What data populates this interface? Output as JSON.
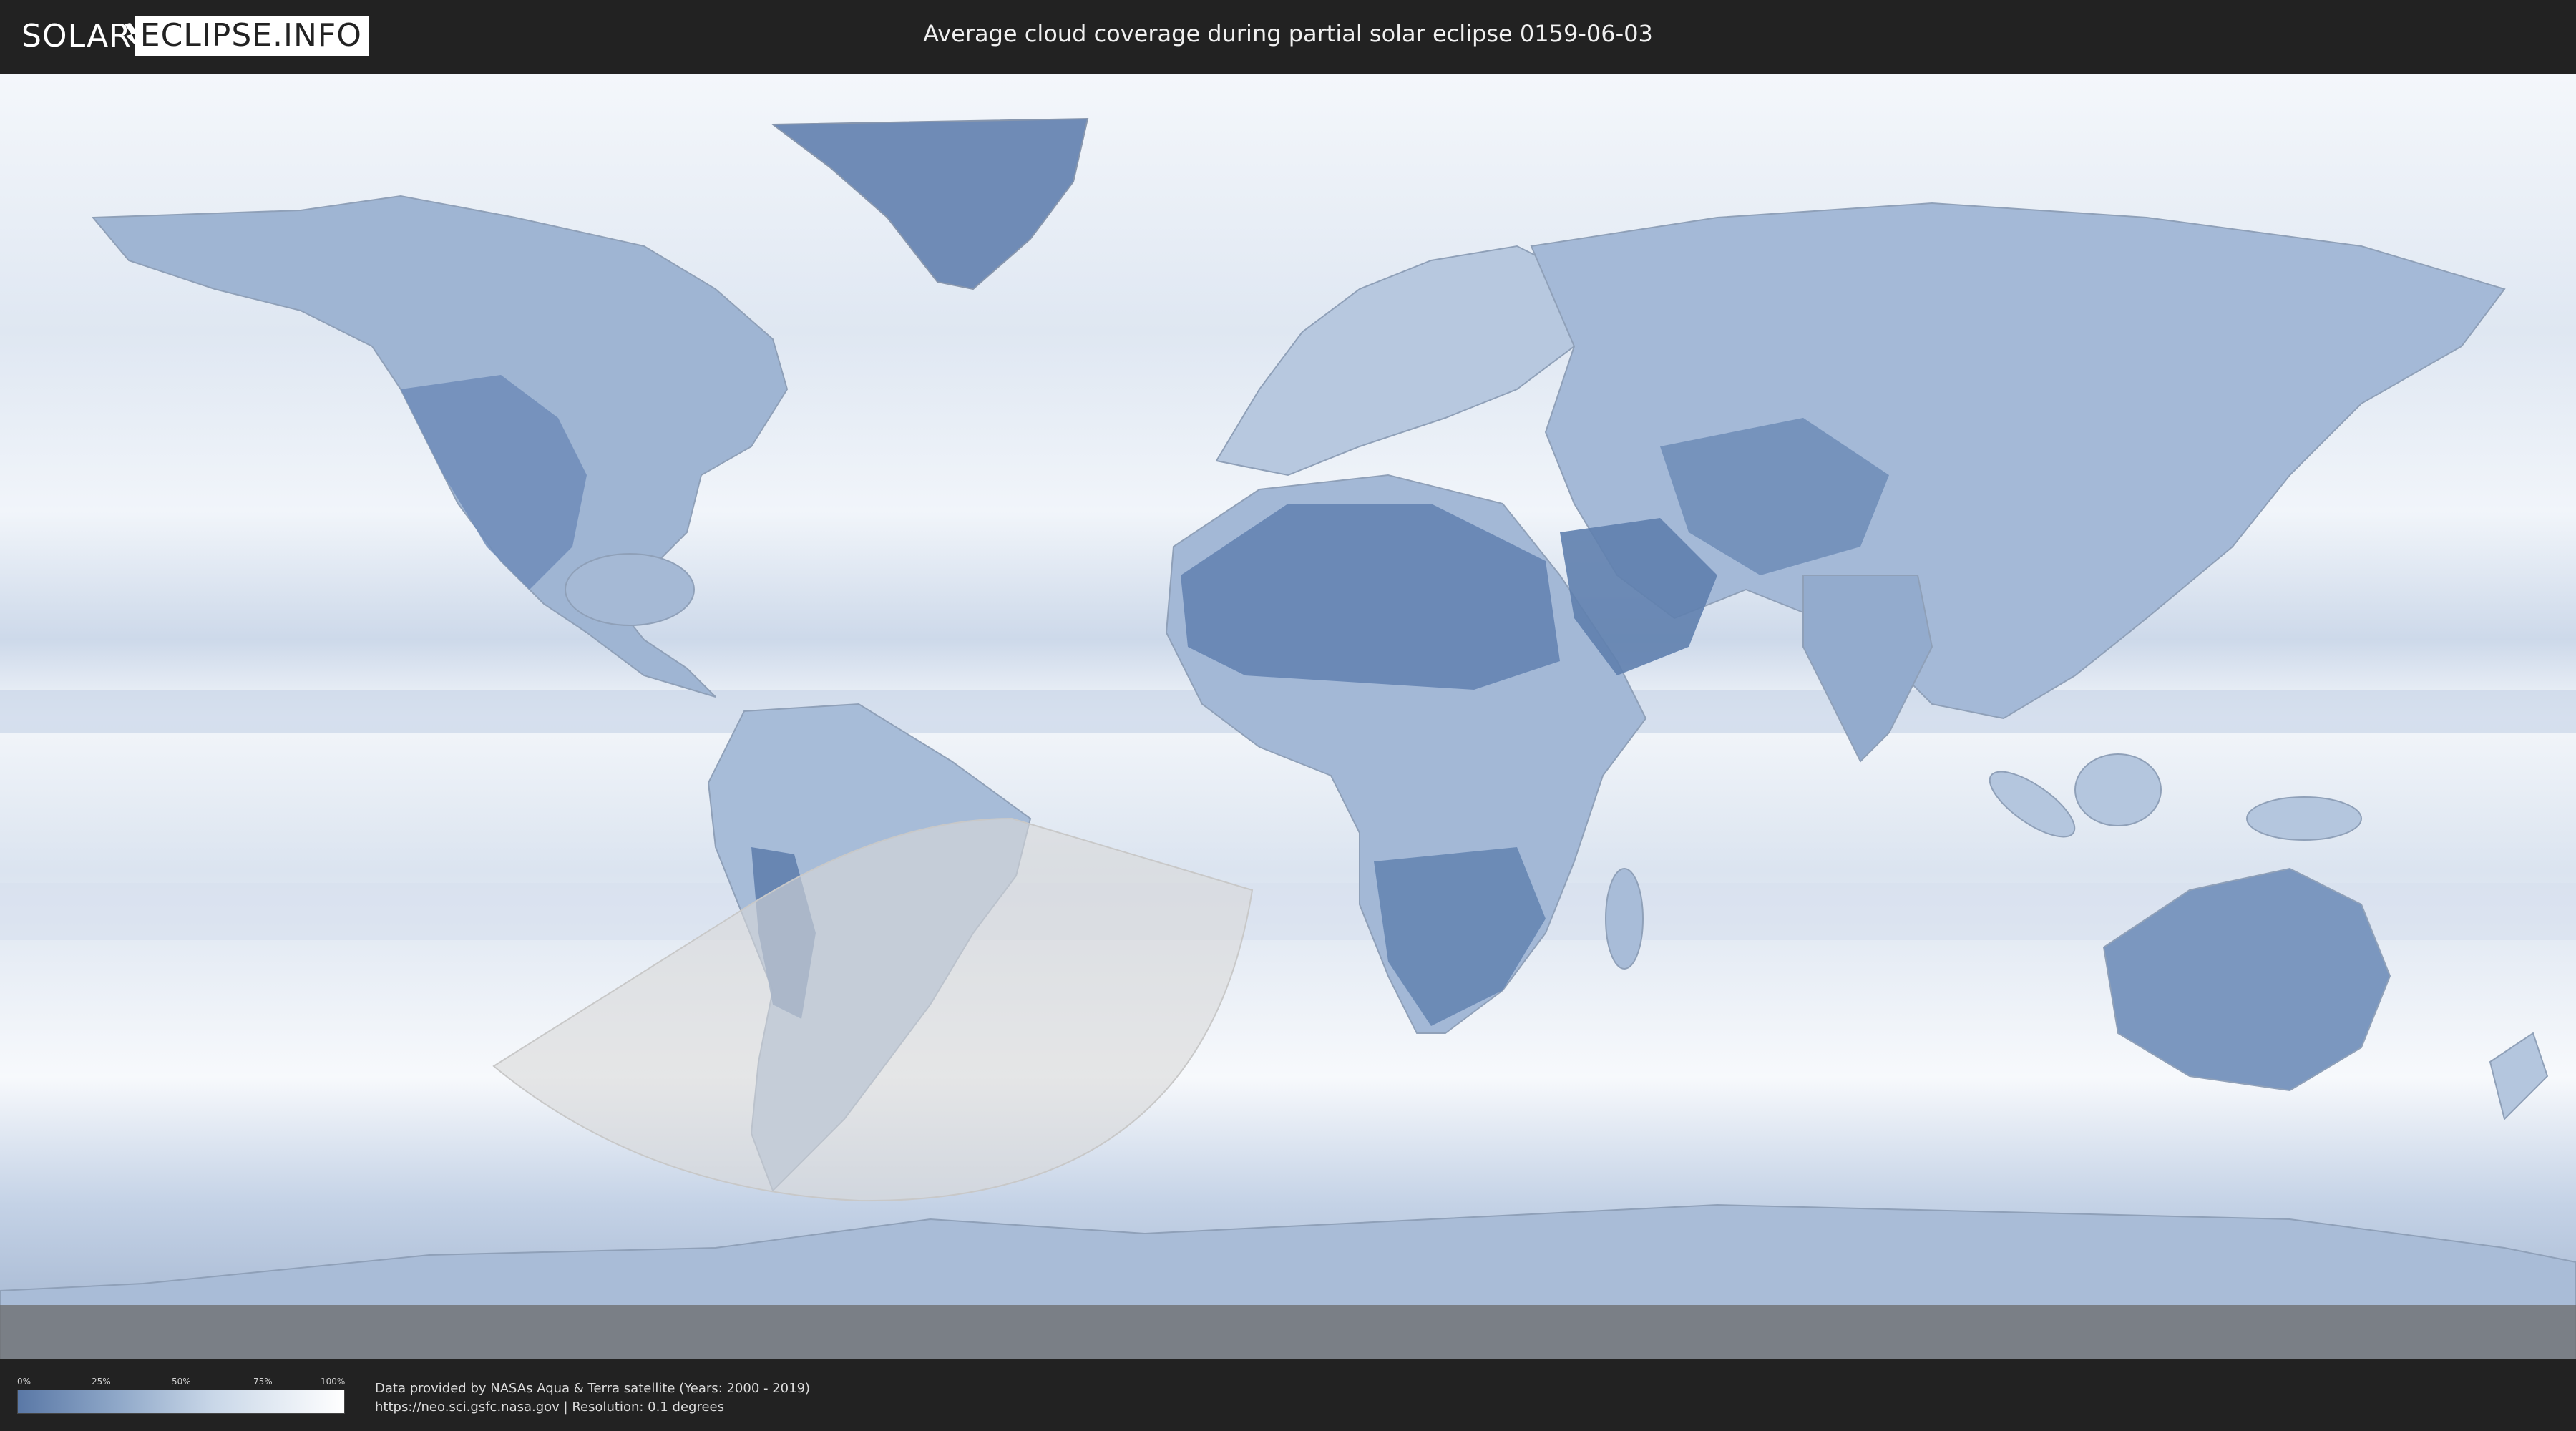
{
  "header": {
    "logo_left": "SOLAR",
    "logo_right": "ECLIPSE.INFO",
    "title": "Average cloud coverage during partial solar eclipse 0159-06-03"
  },
  "legend": {
    "ticks": [
      "0%",
      "25%",
      "50%",
      "75%",
      "100%"
    ],
    "colors": {
      "low": "#5a78a6",
      "high": "#ffffff"
    }
  },
  "footer": {
    "line1": "Data provided by NASAs Aqua & Terra satellite (Years: 2000 - 2019)",
    "line2": "https://neo.sci.gsfc.nasa.gov | Resolution: 0.1 degrees"
  },
  "map": {
    "colors": {
      "ocean_cloudy": "#eef3f9",
      "land_clear": "#5f7fae",
      "land_mid": "#9db3d2",
      "eclipse_zone": "#d9d9d9"
    }
  }
}
